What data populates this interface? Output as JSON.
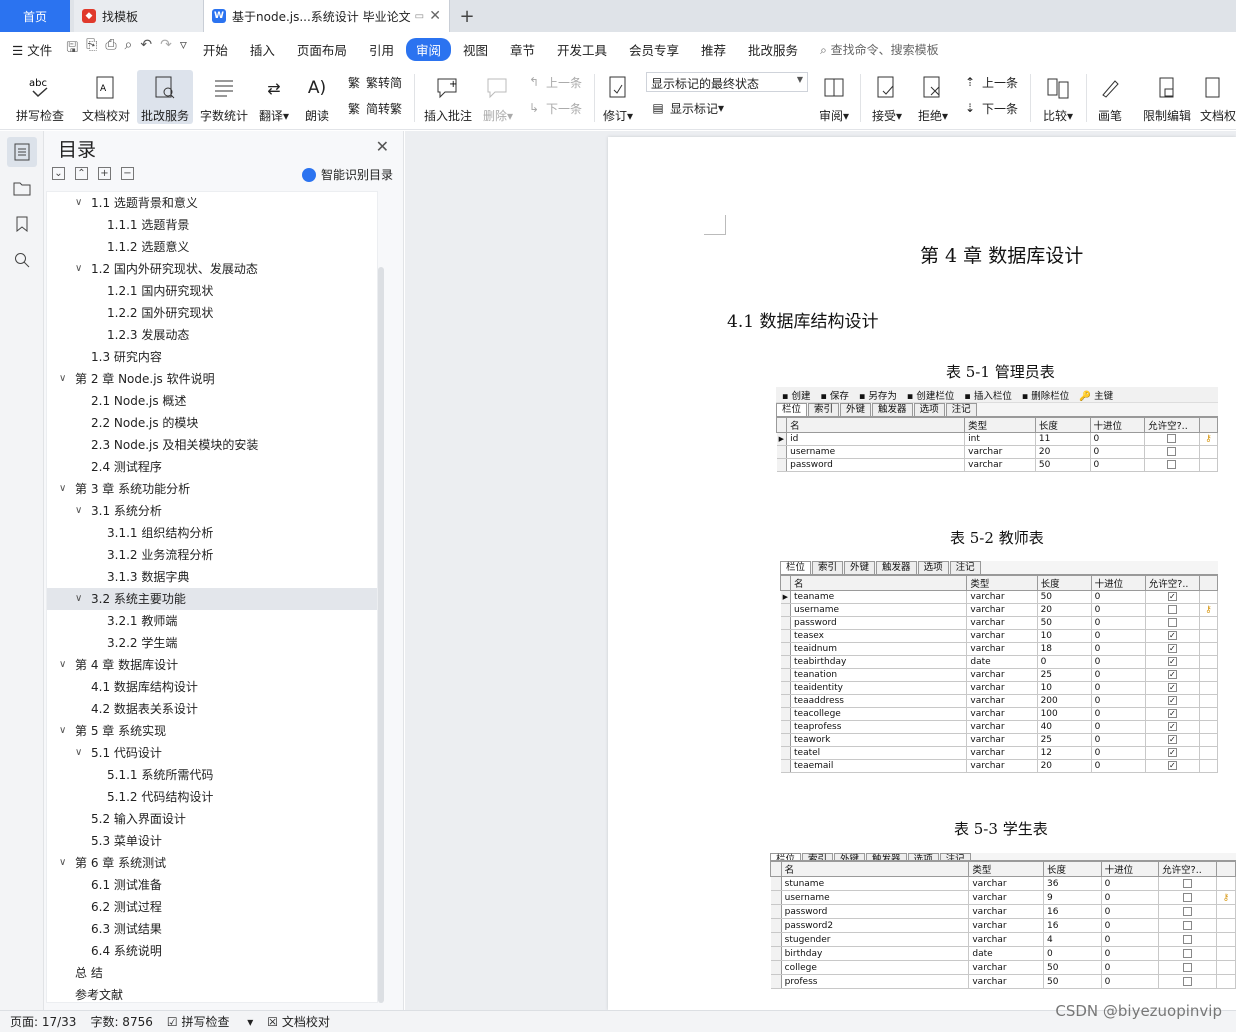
{
  "tabs": {
    "home": "首页",
    "t1": "找模板",
    "t2": "基于node.js...系统设计 毕业论文"
  },
  "menu": {
    "file": "文件",
    "items": [
      "开始",
      "插入",
      "页面布局",
      "引用",
      "审阅",
      "视图",
      "章节",
      "开发工具",
      "会员专享",
      "推荐",
      "批改服务"
    ],
    "active_index": 4,
    "search": "查找命令、搜索模板"
  },
  "ribbon": {
    "spell": "拼写检查",
    "doccheck": "文档校对",
    "grading": "批改服务",
    "wordcount": "字数统计",
    "translate": "翻译",
    "read": "朗读",
    "trad": "繁转简",
    "simp": "简转繁",
    "insert_comment": "插入批注",
    "delete": "删除",
    "prev": "上一条",
    "next": "下一条",
    "revise": "修订",
    "markup_state": "显示标记的最终状态",
    "show_markup": "显示标记",
    "review": "审阅",
    "accept": "接受",
    "reject": "拒绝",
    "prev2": "上一条",
    "next2": "下一条",
    "compare": "比较",
    "pen": "画笔",
    "restrict": "限制编辑",
    "docperm": "文档权"
  },
  "toc": {
    "title": "目录",
    "smart": "智能识别目录",
    "items": [
      {
        "text": "1.1 选题背景和意义",
        "level": 2,
        "chev": true
      },
      {
        "text": "1.1.1 选题背景",
        "level": 3
      },
      {
        "text": "1.1.2 选题意义",
        "level": 3
      },
      {
        "text": "1.2 国内外研究现状、发展动态",
        "level": 2,
        "chev": true
      },
      {
        "text": "1.2.1 国内研究现状",
        "level": 3
      },
      {
        "text": "1.2.2 国外研究现状",
        "level": 3
      },
      {
        "text": "1.2.3 发展动态",
        "level": 3
      },
      {
        "text": "1.3 研究内容",
        "level": 2
      },
      {
        "text": "第 2 章  Node.js 软件说明",
        "level": 1,
        "chev": true
      },
      {
        "text": "2.1 Node.js 概述",
        "level": 2
      },
      {
        "text": "2.2 Node.js 的模块",
        "level": 2
      },
      {
        "text": "2.3 Node.js 及相关模块的安装",
        "level": 2
      },
      {
        "text": "2.4  测试程序",
        "level": 2
      },
      {
        "text": "第 3 章  系统功能分析",
        "level": 1,
        "chev": true
      },
      {
        "text": "3.1 系统分析",
        "level": 2,
        "chev": true
      },
      {
        "text": "3.1.1 组织结构分析",
        "level": 3
      },
      {
        "text": "3.1.2 业务流程分析",
        "level": 3
      },
      {
        "text": "3.1.3 数据字典",
        "level": 3
      },
      {
        "text": "3.2 系统主要功能",
        "level": 2,
        "chev": true,
        "selected": true
      },
      {
        "text": "3.2.1  教师端",
        "level": 3
      },
      {
        "text": "3.2.2  学生端",
        "level": 3
      },
      {
        "text": "第 4 章  数据库设计",
        "level": 1,
        "chev": true
      },
      {
        "text": "4.1 数据库结构设计",
        "level": 2
      },
      {
        "text": "4.2 数据表关系设计",
        "level": 2
      },
      {
        "text": "第 5 章  系统实现",
        "level": 1,
        "chev": true
      },
      {
        "text": "5.1 代码设计",
        "level": 2,
        "chev": true
      },
      {
        "text": "5.1.1 系统所需代码",
        "level": 3
      },
      {
        "text": "5.1.2 代码结构设计",
        "level": 3
      },
      {
        "text": "5.2 输入界面设计",
        "level": 2
      },
      {
        "text": "5.3 菜单设计",
        "level": 2
      },
      {
        "text": "第 6 章  系统测试",
        "level": 1,
        "chev": true
      },
      {
        "text": "6.1 测试准备",
        "level": 2
      },
      {
        "text": "6.2 测试过程",
        "level": 2
      },
      {
        "text": "6.3 测试结果",
        "level": 2
      },
      {
        "text": "6.4 系统说明",
        "level": 2
      },
      {
        "text": "总    结",
        "level": 1
      },
      {
        "text": "参考文献",
        "level": 1
      }
    ]
  },
  "doc": {
    "chapter": "第 4 章  数据库设计",
    "section": "4.1 数据库结构设计",
    "cap1": "表 5-1  管理员表",
    "cap2": "表 5-2    教师表",
    "cap3": "表 5-3  学生表"
  },
  "navicat": {
    "toolbar": [
      "创建",
      "保存",
      "另存为",
      "创建栏位",
      "插入栏位",
      "删除栏位",
      "主键"
    ],
    "tabs": [
      "栏位",
      "索引",
      "外键",
      "触发器",
      "选项",
      "注记"
    ],
    "headers": [
      "名",
      "类型",
      "长度",
      "十进位",
      "允许空?..",
      ""
    ],
    "t1_rows": [
      {
        "name": "id",
        "type": "int",
        "len": "11",
        "dec": "0",
        "null": false,
        "key": true,
        "cur": true
      },
      {
        "name": "username",
        "type": "varchar",
        "len": "20",
        "dec": "0",
        "null": false
      },
      {
        "name": "password",
        "type": "varchar",
        "len": "50",
        "dec": "0",
        "null": false
      }
    ],
    "t2_rows": [
      {
        "name": "teaname",
        "type": "varchar",
        "len": "50",
        "dec": "0",
        "null": true,
        "cur": true
      },
      {
        "name": "username",
        "type": "varchar",
        "len": "20",
        "dec": "0",
        "null": false,
        "key": true
      },
      {
        "name": "password",
        "type": "varchar",
        "len": "50",
        "dec": "0",
        "null": false
      },
      {
        "name": "teasex",
        "type": "varchar",
        "len": "10",
        "dec": "0",
        "null": true
      },
      {
        "name": "teaidnum",
        "type": "varchar",
        "len": "18",
        "dec": "0",
        "null": true
      },
      {
        "name": "teabirthday",
        "type": "date",
        "len": "0",
        "dec": "0",
        "null": true
      },
      {
        "name": "teanation",
        "type": "varchar",
        "len": "25",
        "dec": "0",
        "null": true
      },
      {
        "name": "teaidentity",
        "type": "varchar",
        "len": "10",
        "dec": "0",
        "null": true
      },
      {
        "name": "teaaddress",
        "type": "varchar",
        "len": "200",
        "dec": "0",
        "null": true
      },
      {
        "name": "teacollege",
        "type": "varchar",
        "len": "100",
        "dec": "0",
        "null": true
      },
      {
        "name": "teaprofess",
        "type": "varchar",
        "len": "40",
        "dec": "0",
        "null": true
      },
      {
        "name": "teawork",
        "type": "varchar",
        "len": "25",
        "dec": "0",
        "null": true
      },
      {
        "name": "teatel",
        "type": "varchar",
        "len": "12",
        "dec": "0",
        "null": true
      },
      {
        "name": "teaemail",
        "type": "varchar",
        "len": "20",
        "dec": "0",
        "null": true
      }
    ],
    "t3_rows": [
      {
        "name": "stuname",
        "type": "varchar",
        "len": "36",
        "dec": "0",
        "null": false
      },
      {
        "name": "username",
        "type": "varchar",
        "len": "9",
        "dec": "0",
        "null": false,
        "key": true
      },
      {
        "name": "password",
        "type": "varchar",
        "len": "16",
        "dec": "0",
        "null": false
      },
      {
        "name": "password2",
        "type": "varchar",
        "len": "16",
        "dec": "0",
        "null": false
      },
      {
        "name": "stugender",
        "type": "varchar",
        "len": "4",
        "dec": "0",
        "null": false
      },
      {
        "name": "birthday",
        "type": "date",
        "len": "0",
        "dec": "0",
        "null": false
      },
      {
        "name": "college",
        "type": "varchar",
        "len": "50",
        "dec": "0",
        "null": false
      },
      {
        "name": "profess",
        "type": "varchar",
        "len": "50",
        "dec": "0",
        "null": false
      }
    ]
  },
  "status": {
    "page": "页面: 17/33",
    "words": "字数: 8756",
    "spell": "拼写检查",
    "doccheck": "文档校对",
    "watermark": "CSDN @biyezuopinvip"
  }
}
